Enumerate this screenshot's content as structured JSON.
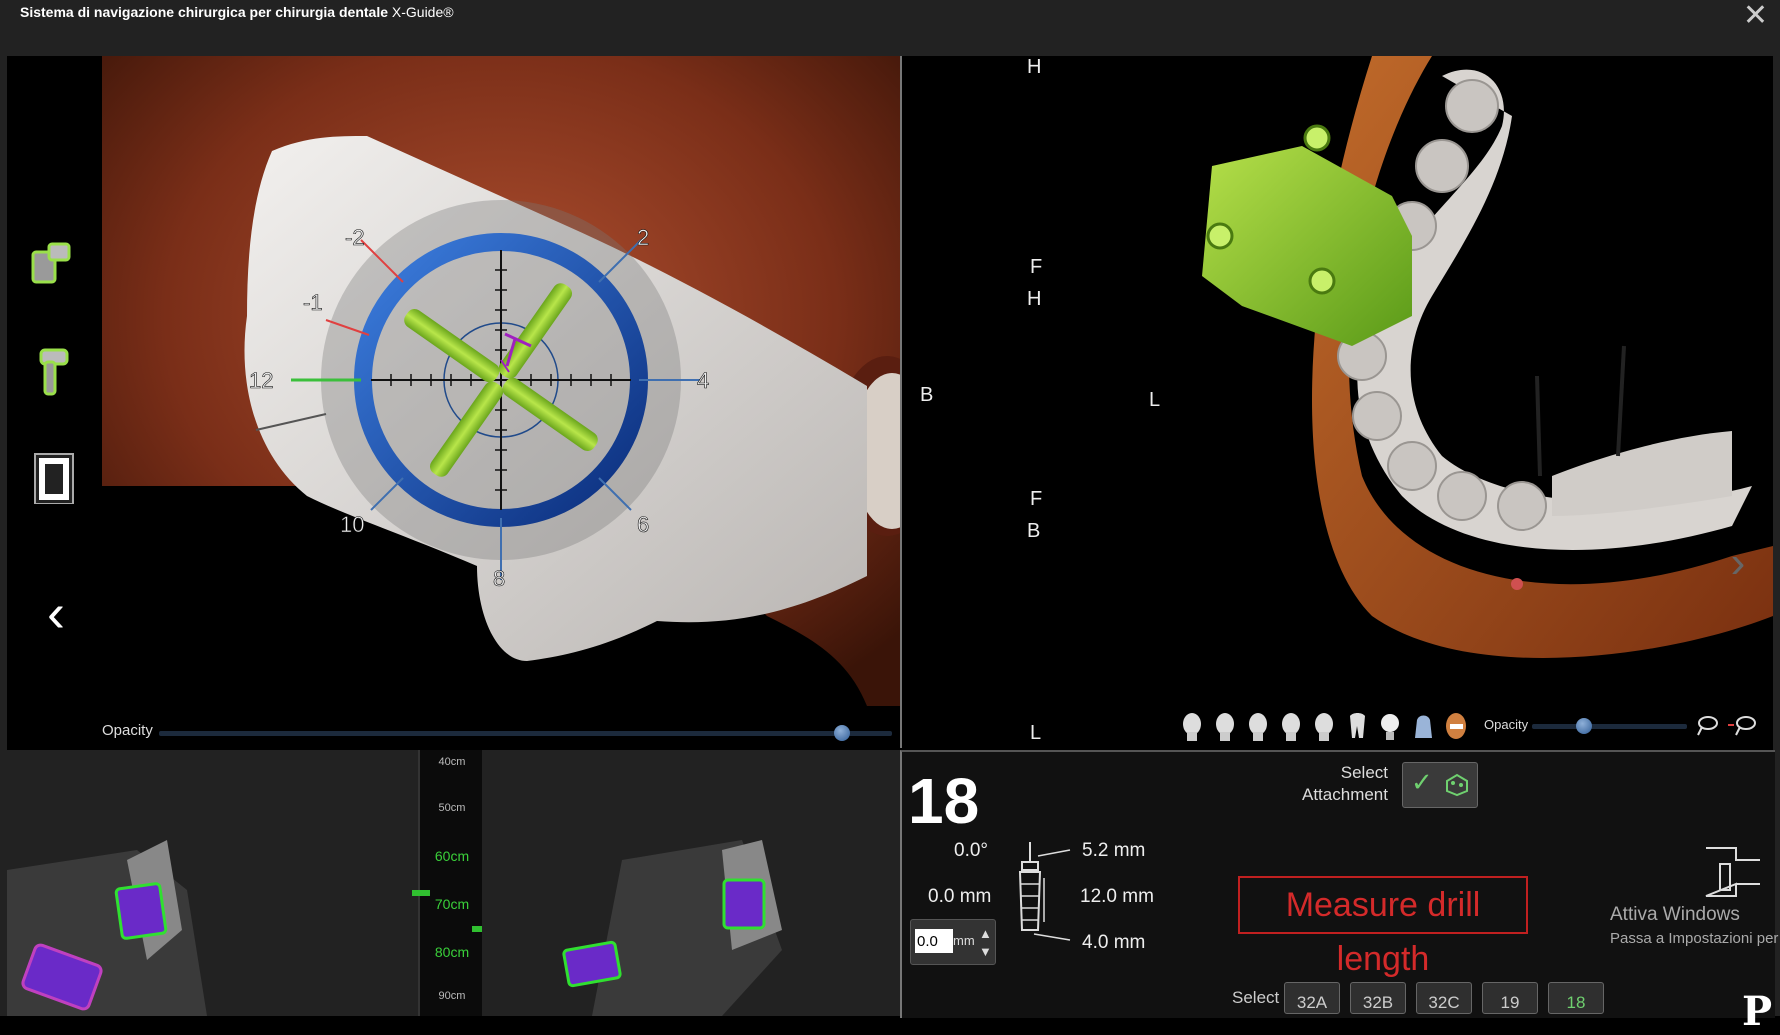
{
  "window": {
    "title_bold": "Sistema di navigazione chirurgica per chirurgia dentale",
    "title_brand": "X-Guide®",
    "close_glyph": "✕"
  },
  "toolbar": {
    "icons": [
      "tracker-icon",
      "drill-icon",
      "pattern-icon"
    ],
    "back_glyph": "‹"
  },
  "main_view": {
    "dial_labels": [
      "-2",
      "-1",
      "12",
      "2",
      "4",
      "10",
      "8",
      "6"
    ],
    "opacity_label": "Opacity",
    "opacity_level": 0.95
  },
  "orientation": {
    "labels": [
      "H",
      "F",
      "H",
      "B",
      "L",
      "F",
      "B",
      "L"
    ]
  },
  "jaw_view": {
    "opacity_label": "Opacity",
    "opacity_level": 0.3,
    "next_glyph": "›"
  },
  "depth_scale": {
    "labels": [
      "40cm",
      "50cm",
      "60cm",
      "70cm",
      "80cm",
      "90cm"
    ],
    "highlighted": [
      "60cm",
      "70cm",
      "80cm"
    ]
  },
  "info": {
    "tooth_number": "18",
    "angle": "0.0°",
    "offset_mm": "0.0 mm",
    "offset_input": "0.0",
    "offset_unit": "mm",
    "diameter_top": "5.2 mm",
    "length": "12.0 mm",
    "diameter_bottom": "4.0 mm",
    "select_attachment_line1": "Select",
    "select_attachment_line2": "Attachment",
    "measure_drill_length": "Measure drill length",
    "activate_windows": "Attiva Windows",
    "activate_windows_sub": "Passa a Impostazioni per a",
    "select_label": "Select",
    "drills": [
      "32A",
      "32B",
      "32C",
      "19",
      "18"
    ],
    "corner_glyph": "P"
  },
  "colors": {
    "accent_green": "#8fd13a",
    "ring_blue": "#1e5fc8",
    "bone_orange": "#8a3a1e",
    "measure_red": "#d42a2a"
  }
}
